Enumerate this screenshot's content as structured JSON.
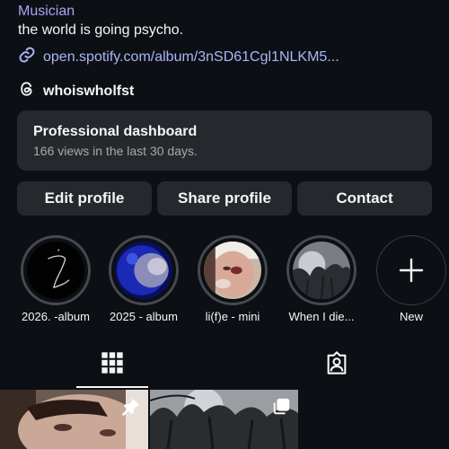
{
  "profile": {
    "category": "Musician",
    "bio": "the world is going psycho.",
    "link": "open.spotify.com/album/3nSD61Cgl1NLKM5...",
    "threads_handle": "whoiswholfst"
  },
  "dashboard": {
    "title": "Professional dashboard",
    "subtitle": "166 views in the last 30 days."
  },
  "actions": {
    "edit": "Edit profile",
    "share": "Share profile",
    "contact": "Contact"
  },
  "highlights": [
    {
      "label": "2026. -album"
    },
    {
      "label": "2025 - album"
    },
    {
      "label": "li(f)e - mini"
    },
    {
      "label": "When I die..."
    }
  ],
  "new_highlight": {
    "label": "New"
  },
  "tabs": {
    "grid_icon": "grid-icon",
    "tagged_icon": "tagged-person-icon"
  },
  "posts": [
    {
      "badge_icon": "pin-icon"
    },
    {
      "badge_icon": "carousel-icon"
    }
  ],
  "colors": {
    "background": "#0c1014",
    "card": "#25292e",
    "category_text": "#a8a4f5",
    "link_text": "#a9b6f7",
    "secondary_text": "#a8a8a8"
  }
}
